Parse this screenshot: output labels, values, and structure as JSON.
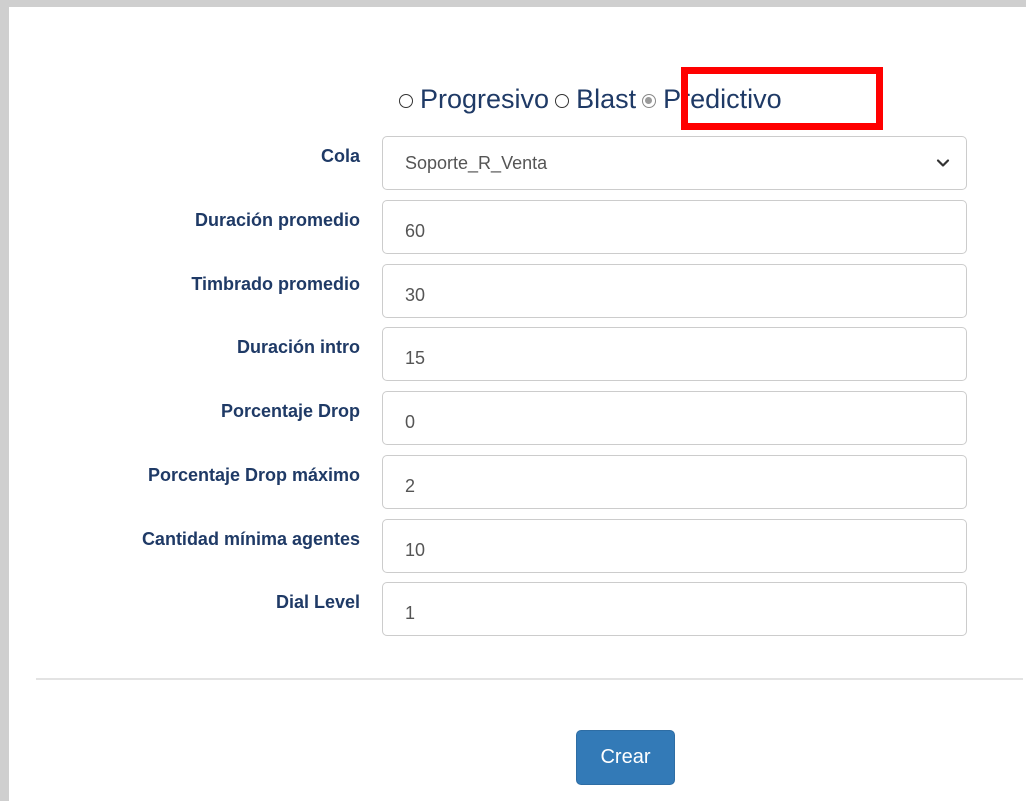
{
  "dialer_mode": {
    "options": [
      {
        "label": "Progresivo",
        "checked": false
      },
      {
        "label": "Blast",
        "checked": false
      },
      {
        "label": "Predictivo",
        "checked": true
      }
    ]
  },
  "form": {
    "cola": {
      "label": "Cola",
      "value": "Soporte_R_Venta"
    },
    "duracion_promedio": {
      "label": "Duración promedio",
      "value": "60"
    },
    "timbrado_promedio": {
      "label": "Timbrado promedio",
      "value": "30"
    },
    "duracion_intro": {
      "label": "Duración intro",
      "value": "15"
    },
    "porcentaje_drop": {
      "label": "Porcentaje Drop",
      "value": "0"
    },
    "porcentaje_drop_maximo": {
      "label": "Porcentaje Drop máximo",
      "value": "2"
    },
    "cantidad_minima_agentes": {
      "label": "Cantidad mínima agentes",
      "value": "10"
    },
    "dial_level": {
      "label": "Dial Level",
      "value": "1"
    }
  },
  "actions": {
    "submit_label": "Crear"
  },
  "colors": {
    "label_text": "#1f3a66",
    "highlight": "#ff0000",
    "primary_button": "#337ab7",
    "frame_border": "#cfcfcf"
  },
  "icons": {
    "select_arrow": "chevron-down-icon"
  }
}
